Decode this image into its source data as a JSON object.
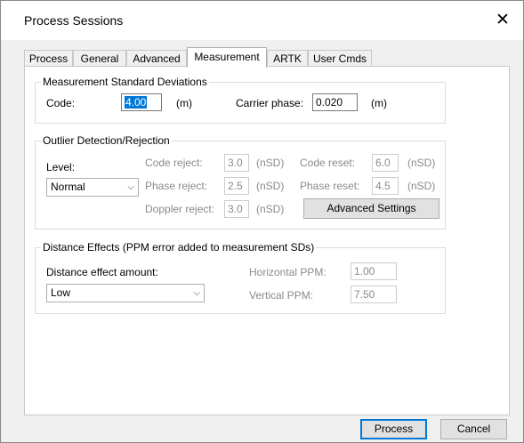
{
  "window": {
    "title": "Process Sessions",
    "close_glyph": "✕"
  },
  "tabs": [
    {
      "label": "Process"
    },
    {
      "label": "General"
    },
    {
      "label": "Advanced"
    },
    {
      "label": "Measurement",
      "active": true
    },
    {
      "label": "ARTK"
    },
    {
      "label": "User Cmds"
    }
  ],
  "msd": {
    "title": "Measurement Standard Deviations",
    "code_label": "Code:",
    "code_value": "4.00",
    "code_unit": "(m)",
    "carrier_label": "Carrier phase:",
    "carrier_value": "0.020",
    "carrier_unit": "(m)"
  },
  "outlier": {
    "title": "Outlier Detection/Rejection",
    "level_label": "Level:",
    "level_value": "Normal",
    "code_reject_label": "Code reject:",
    "code_reject_value": "3.0",
    "phase_reject_label": "Phase reject:",
    "phase_reject_value": "2.5",
    "doppler_reject_label": "Doppler reject:",
    "doppler_reject_value": "3.0",
    "code_reset_label": "Code reset:",
    "code_reset_value": "6.0",
    "phase_reset_label": "Phase reset:",
    "phase_reset_value": "4.5",
    "unit": "(nSD)",
    "advanced_button": "Advanced Settings"
  },
  "distance": {
    "title": "Distance Effects (PPM error added to measurement SDs)",
    "amount_label": "Distance effect amount:",
    "amount_value": "Low",
    "horizontal_label": "Horizontal PPM:",
    "horizontal_value": "1.00",
    "vertical_label": "Vertical PPM:",
    "vertical_value": "7.50"
  },
  "footer": {
    "process_button": "Process",
    "cancel_button": "Cancel"
  },
  "colors": {
    "accent": "#0078d7",
    "disabled_text": "#8a8a8a",
    "dialog_bg": "#f0f0f0"
  },
  "icons": {
    "close": "close-icon",
    "dropdown": "chevron-down-icon"
  }
}
